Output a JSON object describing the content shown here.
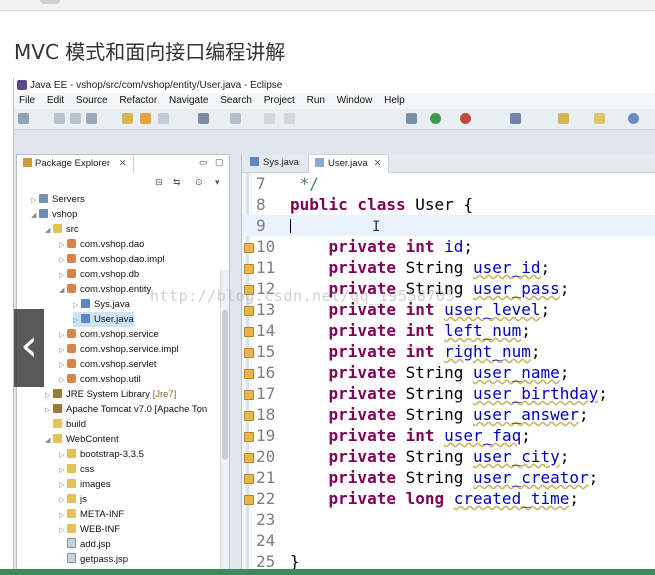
{
  "page": {
    "title": "MVC 模式和面向接口编程讲解"
  },
  "window": {
    "title": "Java EE - vshop/src/com/vshop/entity/User.java - Eclipse"
  },
  "menu": [
    "File",
    "Edit",
    "Source",
    "Refactor",
    "Navigate",
    "Search",
    "Project",
    "Run",
    "Window",
    "Help"
  ],
  "package_explorer": {
    "tab_label": "Package Explorer",
    "tab_close": "✕",
    "tree": [
      {
        "label": "Servers",
        "suffix": "",
        "icon": "server"
      },
      {
        "label": "vshop",
        "suffix": "",
        "icon": "project"
      },
      {
        "label": "src",
        "suffix": "",
        "icon": "folder"
      },
      {
        "label": "com.vshop.dao",
        "suffix": "",
        "icon": "package"
      },
      {
        "label": "com.vshop.dao.impl",
        "suffix": "",
        "icon": "package"
      },
      {
        "label": "com.vshop.db",
        "suffix": "",
        "icon": "package"
      },
      {
        "label": "com.vshop.entity",
        "suffix": "",
        "icon": "package"
      },
      {
        "label": "Sys.java",
        "suffix": "",
        "icon": "java"
      },
      {
        "label": "User.java",
        "suffix": "",
        "icon": "java"
      },
      {
        "label": "com.vshop.service",
        "suffix": "",
        "icon": "package"
      },
      {
        "label": "com.vshop.service.impl",
        "suffix": "",
        "icon": "package"
      },
      {
        "label": "com.vshop.servlet",
        "suffix": "",
        "icon": "package"
      },
      {
        "label": "com.vshop.util",
        "suffix": "",
        "icon": "package"
      },
      {
        "label": "JRE System Library ",
        "suffix": "[Jre7]",
        "icon": "library"
      },
      {
        "label": "Apache Tomcat v7.0 [Apache Ton",
        "suffix": "",
        "icon": "library"
      },
      {
        "label": "build",
        "suffix": "",
        "icon": "folder"
      },
      {
        "label": "WebContent",
        "suffix": "",
        "icon": "folder"
      },
      {
        "label": "bootstrap-3.3.5",
        "suffix": "",
        "icon": "folder"
      },
      {
        "label": "css",
        "suffix": "",
        "icon": "folder"
      },
      {
        "label": "images",
        "suffix": "",
        "icon": "folder"
      },
      {
        "label": "js",
        "suffix": "",
        "icon": "folder"
      },
      {
        "label": "META-INF",
        "suffix": "",
        "icon": "folder"
      },
      {
        "label": "WEB-INF",
        "suffix": "",
        "icon": "folder"
      },
      {
        "label": "add.jsp",
        "suffix": "",
        "icon": "jsp"
      },
      {
        "label": "getpass.jsp",
        "suffix": "",
        "icon": "jsp"
      }
    ]
  },
  "editor": {
    "tabs": [
      {
        "label": "Sys.java",
        "close": ""
      },
      {
        "label": "User.java",
        "close": "✕"
      }
    ],
    "lines": [
      {
        "num": "7",
        "text": " */"
      },
      {
        "num": "8",
        "text": "public class User {"
      },
      {
        "num": "9",
        "text": ""
      },
      {
        "num": "10",
        "text": "    private int id;"
      },
      {
        "num": "11",
        "text": "    private String user_id;"
      },
      {
        "num": "12",
        "text": "    private String user_pass;"
      },
      {
        "num": "13",
        "text": "    private int user_level;"
      },
      {
        "num": "14",
        "text": "    private int left_num;"
      },
      {
        "num": "15",
        "text": "    private int right_num;"
      },
      {
        "num": "16",
        "text": "    private String user_name;"
      },
      {
        "num": "17",
        "text": "    private String user_birthday;"
      },
      {
        "num": "18",
        "text": "    private String user_answer;"
      },
      {
        "num": "19",
        "text": "    private int user_faq;"
      },
      {
        "num": "20",
        "text": "    private String user_city;"
      },
      {
        "num": "21",
        "text": "    private String user_creator;"
      },
      {
        "num": "22",
        "text": "    private long created_time;"
      },
      {
        "num": "23",
        "text": ""
      },
      {
        "num": "24",
        "text": ""
      },
      {
        "num": "25",
        "text": "}"
      }
    ]
  },
  "watermark": "http://blog.csdn.net/qq_19558705"
}
